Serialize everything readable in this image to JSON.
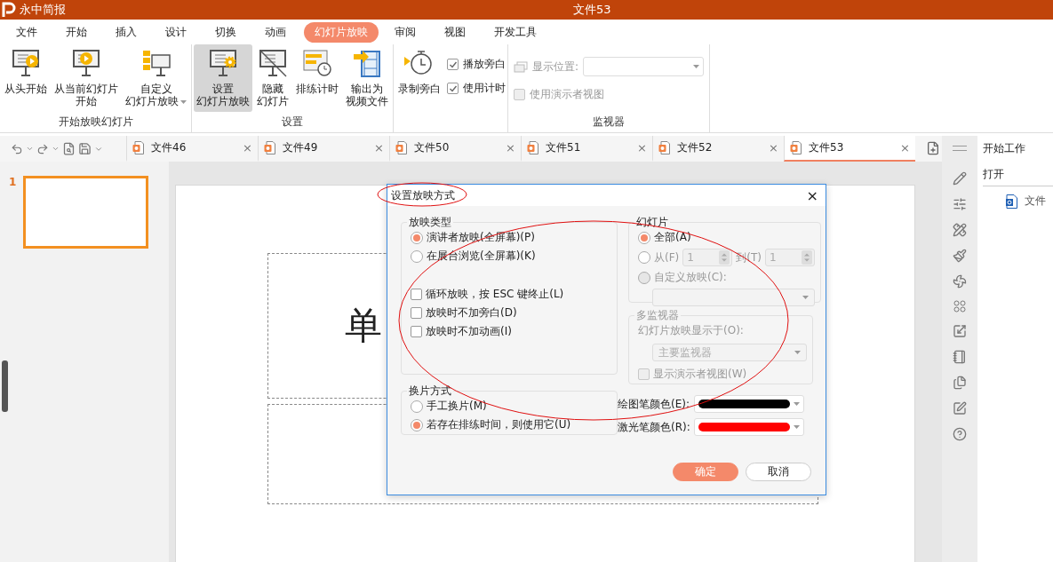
{
  "app": {
    "name": "永中简报",
    "document_title": "文件53"
  },
  "menu_tabs": [
    {
      "label": "文件",
      "selected": false
    },
    {
      "label": "开始",
      "selected": false
    },
    {
      "label": "插入",
      "selected": false
    },
    {
      "label": "设计",
      "selected": false
    },
    {
      "label": "切换",
      "selected": false
    },
    {
      "label": "动画",
      "selected": false
    },
    {
      "label": "幻灯片放映",
      "selected": true
    },
    {
      "label": "审阅",
      "selected": false
    },
    {
      "label": "视图",
      "selected": false
    },
    {
      "label": "开发工具",
      "selected": false
    }
  ],
  "ribbon_groups": [
    {
      "title": "开始放映幻灯片",
      "items": [
        {
          "kind": "large",
          "lines": [
            "从头开始"
          ],
          "selected": false
        },
        {
          "kind": "large",
          "lines": [
            "从当前幻灯片",
            "开始"
          ],
          "selected": false
        },
        {
          "kind": "large",
          "lines": [
            "自定义",
            "幻灯片放映"
          ],
          "has_menu": true,
          "selected": false
        }
      ]
    },
    {
      "title": "设置",
      "items": [
        {
          "kind": "large",
          "lines": [
            "设置",
            "幻灯片放映"
          ],
          "selected": true
        },
        {
          "kind": "large",
          "lines": [
            "隐藏",
            "幻灯片"
          ],
          "selected": false
        },
        {
          "kind": "large",
          "lines": [
            "排练计时"
          ],
          "selected": false
        },
        {
          "kind": "large",
          "lines": [
            "输出为",
            "视频文件"
          ],
          "selected": false
        }
      ]
    },
    {
      "items": [
        {
          "kind": "large",
          "lines": [
            "录制旁白"
          ],
          "selected": false
        },
        {
          "kind": "checks",
          "checks": [
            {
              "label": "播放旁白",
              "checked": true
            },
            {
              "label": "使用计时",
              "checked": true
            }
          ]
        }
      ]
    },
    {
      "title": "监视器",
      "items": [
        {
          "kind": "monitor",
          "select_label": "显示位置:",
          "check": {
            "label": "使用演示者视图",
            "checked": false
          }
        }
      ]
    }
  ],
  "doc_tabs": [
    {
      "label": "文件46",
      "selected": false,
      "close": "×"
    },
    {
      "label": "文件49",
      "selected": false,
      "close": "×"
    },
    {
      "label": "文件50",
      "selected": false,
      "close": "×"
    },
    {
      "label": "文件51",
      "selected": false,
      "close": "×"
    },
    {
      "label": "文件52",
      "selected": false,
      "close": "×"
    },
    {
      "label": "文件53",
      "selected": true,
      "close": "×"
    }
  ],
  "slides": [
    {
      "number": "1",
      "selected": true
    }
  ],
  "slide": {
    "visible_text": "单"
  },
  "task_pane": {
    "title": "开始工作",
    "section": "打开",
    "files": [
      "文件"
    ]
  },
  "dialog": {
    "title": "设置放映方式",
    "close": "×",
    "show_type": {
      "title": "放映类型",
      "options": [
        {
          "label": "演讲者放映(全屏幕)(P)",
          "selected": true
        },
        {
          "label": "在展台浏览(全屏幕)(K)",
          "selected": false
        }
      ],
      "checks": [
        {
          "label": "循环放映，按 ESC 键终止(L)",
          "checked": false
        },
        {
          "label": "放映时不加旁白(D)",
          "checked": false
        },
        {
          "label": "放映时不加动画(I)",
          "checked": false
        }
      ]
    },
    "advance": {
      "title": "换片方式",
      "options": [
        {
          "label": "手工换片(M)",
          "selected": false
        },
        {
          "label": "若存在排练时间，则使用它(U)",
          "selected": true
        }
      ]
    },
    "slides": {
      "title": "幻灯片",
      "all": {
        "label": "全部(A)",
        "selected": true
      },
      "range": {
        "label": "从(F)",
        "selected": false,
        "from": "1",
        "to_label": "到(T)",
        "to": "1"
      },
      "custom": {
        "label": "自定义放映(C):",
        "selected": false,
        "disabled": true
      }
    },
    "monitors": {
      "title": "多监视器",
      "label": "幻灯片放映显示于(O):",
      "value": "主要监视器",
      "check": {
        "label": "显示演示者视图(W)",
        "checked": false
      }
    },
    "colors": [
      {
        "label": "绘图笔颜色(E):",
        "color": "#000000"
      },
      {
        "label": "激光笔颜色(R):",
        "color": "#ff0000"
      }
    ],
    "buttons": [
      {
        "label": "确定",
        "kind": "primary"
      },
      {
        "label": "取消",
        "kind": "secondary"
      }
    ]
  }
}
